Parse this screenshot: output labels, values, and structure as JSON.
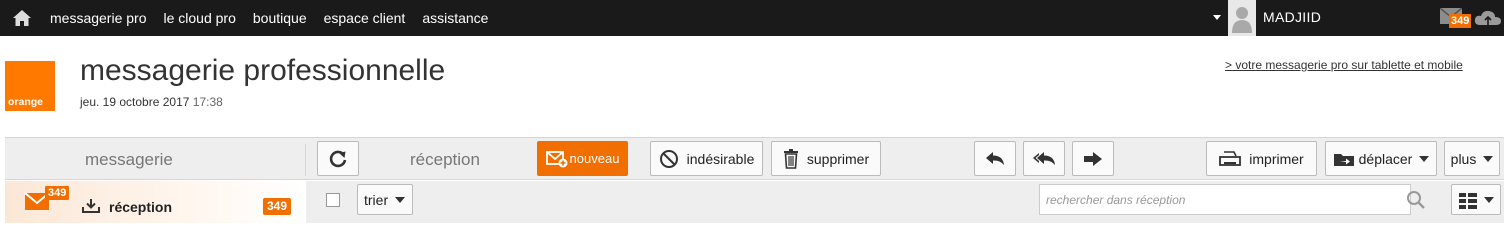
{
  "topbar": {
    "nav": [
      "messagerie pro",
      "le cloud pro",
      "boutique",
      "espace client",
      "assistance"
    ],
    "user": "MADJIID",
    "mail_badge": "349"
  },
  "header": {
    "logo_text": "orange",
    "title": "messagerie professionnelle",
    "date": "jeu. 19 octobre 2017",
    "time": "17:38",
    "tablet_link": "> votre messagerie pro sur tablette et mobile"
  },
  "toolbar": {
    "section_label": "messagerie",
    "folder_label": "réception",
    "new_label": "nouveau",
    "junk_label": "indésirable",
    "delete_label": "supprimer",
    "print_label": "imprimer",
    "move_label": "déplacer",
    "more_label": "plus"
  },
  "sidebar": {
    "envelope_badge": "349",
    "inbox_label": "réception",
    "inbox_count": "349"
  },
  "list": {
    "sort_label": "trier",
    "search_placeholder": "rechercher dans réception"
  },
  "colors": {
    "brand": "#ff7900",
    "accent": "#f16e00",
    "topbar": "#1a1a1a"
  }
}
